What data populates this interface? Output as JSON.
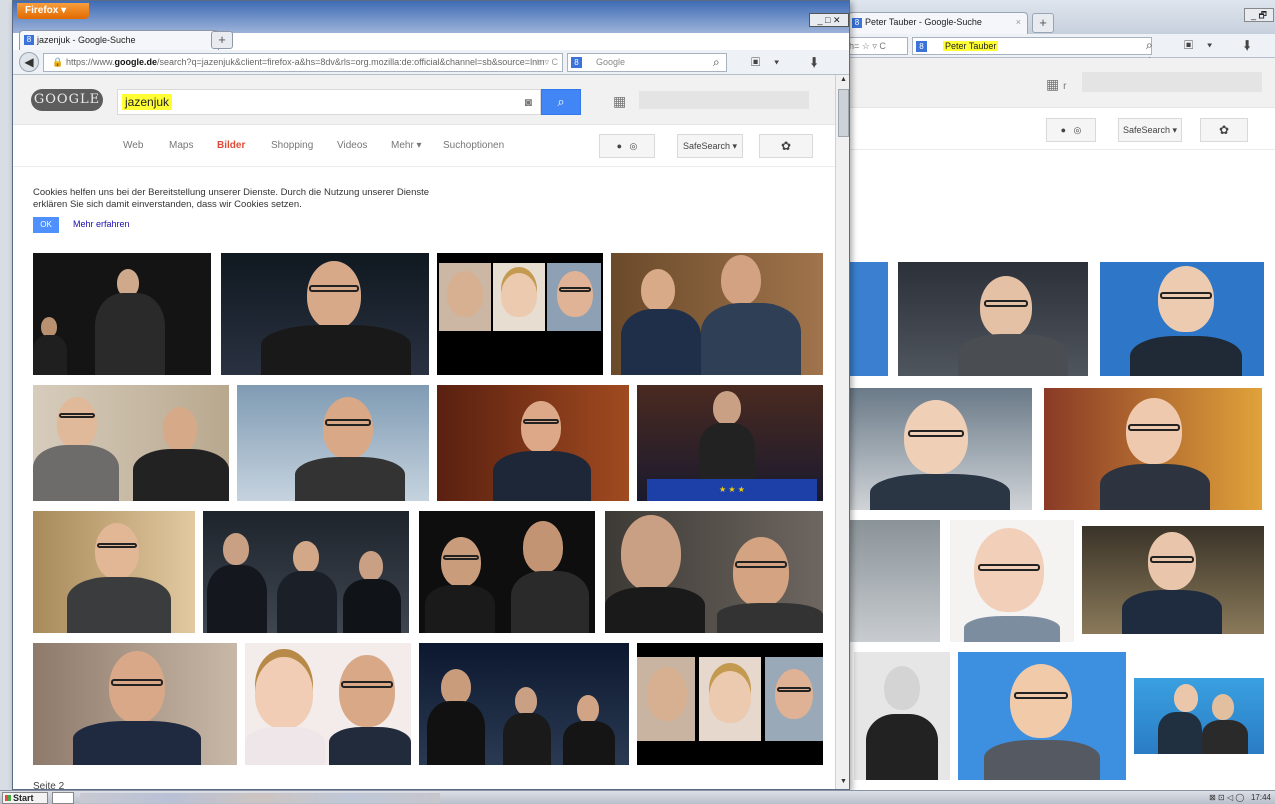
{
  "back_window": {
    "tab_title": "Peter Tauber - Google-Suche",
    "tab_close": "×",
    "new_tab": "+",
    "window_controls": "_ 🗗",
    "url_fragment": "h= ☆ ▿ C",
    "search_engine_icon": "8",
    "search_query": "Peter Tauber",
    "nav_icons": "⌕ ▣▾ ⬇ ⌂",
    "safesearch": "SafeSearch ▾",
    "apps_icon": "▦",
    "apps_initial": "r"
  },
  "front_window": {
    "browser_button": "Firefox ▾",
    "tab_title": "jazenjuk - Google-Suche",
    "new_tab": "+",
    "window_controls": "_ □ ✕",
    "back_arrow": "◀",
    "url_prefix": "https://www.",
    "url_domain": "google.de",
    "url_rest": "/search?q=jazenjuk&client=firefox-a&hs=8dv&rls=org.mozilla:de:official&channel=sb&source=lnm",
    "url_icons": "☆ ▿ C",
    "search_engine_icon": "8",
    "search_engine": "Google",
    "nav_icons": "⌕ ▣▾ ⬇ ⌂",
    "lock_icon": "🔒",
    "scroll_up": "▲",
    "scroll_down": "▼"
  },
  "google": {
    "logo": "GOOGLE",
    "query": "jazenjuk",
    "camera_icon": "◙",
    "search_icon": "⌕",
    "apps_icon": "▦",
    "nav": {
      "web": "Web",
      "maps": "Maps",
      "bilder": "Bilder",
      "shopping": "Shopping",
      "videos": "Videos",
      "mehr": "Mehr ▾",
      "suchoptionen": "Suchoptionen"
    },
    "person_icon": "●",
    "globe_icon": "◎",
    "safesearch": "SafeSearch ▾",
    "settings_icon": "✿",
    "cookie_notice": "Cookies helfen uns bei der Bereitstellung unserer Dienste. Durch die Nutzung unserer Dienste erklären Sie sich damit einverstanden, dass wir Cookies setzen.",
    "ok": "OK",
    "more": "Mehr erfahren",
    "page_label": "Seite 2"
  },
  "taskbar": {
    "start": "Start",
    "clock": "17:44",
    "tray_icons": "⊠ ⊡ ◁ ◯"
  },
  "colors": {
    "accent": "#4285f4",
    "active_tab": "#dd4b39",
    "highlight": "#ffff33",
    "firefox": "#e26a00"
  }
}
